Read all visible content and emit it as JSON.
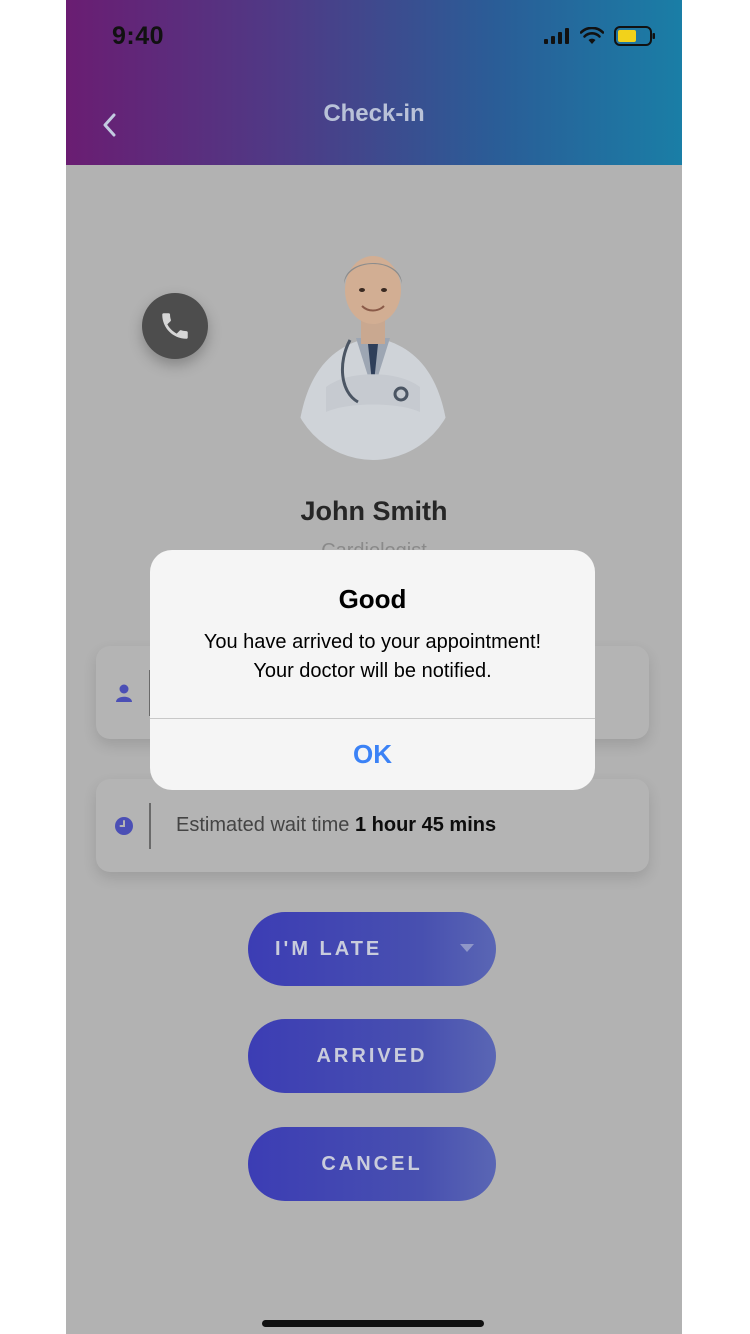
{
  "status_bar": {
    "time": "9:40"
  },
  "header": {
    "title": "Check-in"
  },
  "doctor": {
    "name": "John Smith",
    "specialty": "Cardiologist"
  },
  "cards": {
    "wait_label": "Estimated wait time",
    "wait_value": "1 hour 45 mins"
  },
  "buttons": {
    "late": "I'M LATE",
    "arrived": "ARRIVED",
    "cancel": "CANCEL"
  },
  "alert": {
    "title": "Good",
    "message_line1": "You have arrived to your appointment!",
    "message_line2": "Your doctor will be notified.",
    "ok": "OK"
  },
  "colors": {
    "header_gradient_start": "#6a1d72",
    "header_gradient_end": "#1a7ea6",
    "button_primary": "#4146b2",
    "alert_action": "#3b82f6"
  },
  "icons": {
    "back": "chevron-left-icon",
    "call": "phone-icon",
    "person": "person-icon",
    "clock": "clock-icon",
    "dropdown": "caret-down-icon"
  }
}
